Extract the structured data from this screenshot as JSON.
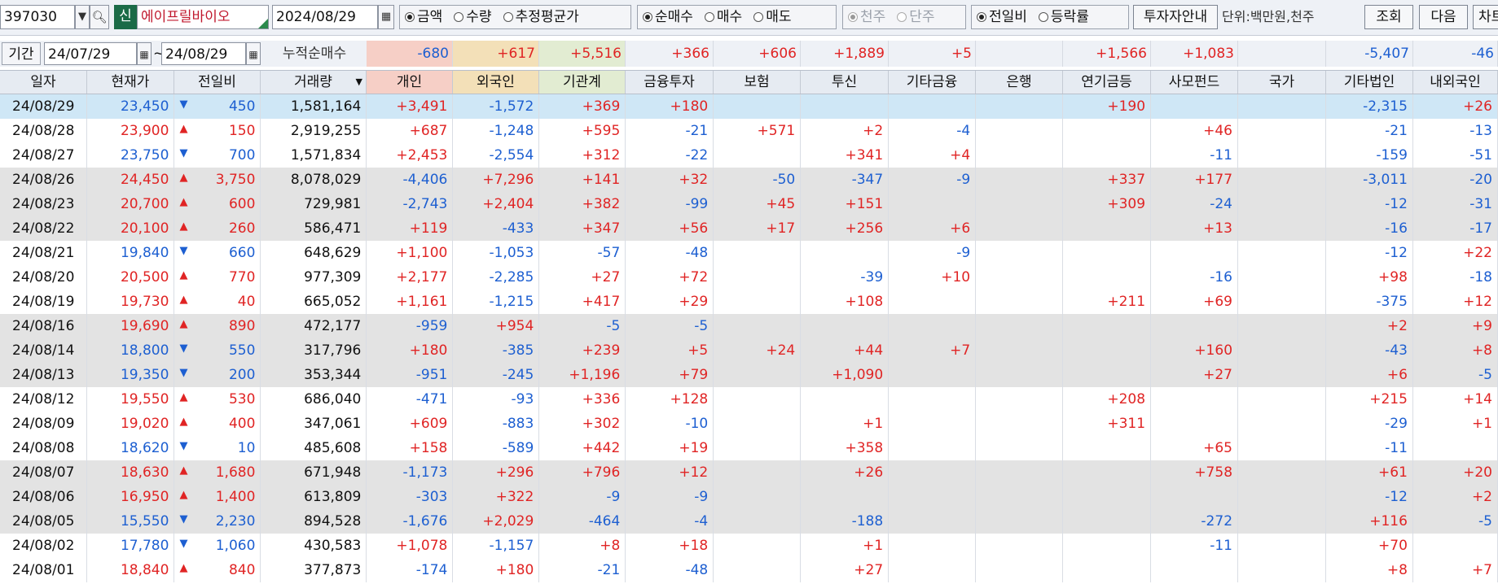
{
  "toolbar": {
    "code": "397030",
    "badge": "신",
    "name": "에이프릴바이오",
    "date": "2024/08/29",
    "value_type": [
      "금액",
      "수량",
      "추정평균가"
    ],
    "trade_type": [
      "순매수",
      "매수",
      "매도"
    ],
    "unit_type": [
      "천주",
      "단주"
    ],
    "compare_type": [
      "전일비",
      "등락률"
    ],
    "guide_button": "투자자안내",
    "unit_text": "단위:백만원,천주",
    "query_button": "조회",
    "next_button": "다음",
    "chart_button": "차트"
  },
  "period": {
    "label": "기간",
    "from": "24/07/29",
    "tilde": "~",
    "to": "24/08/29",
    "cumulative_label": "누적순매수",
    "cumulative_values": [
      "-680",
      "+617",
      "+5,516",
      "+366",
      "+606",
      "+1,889",
      "+5",
      "",
      "+1,566",
      "+1,083",
      "",
      "-5,407",
      "-46"
    ]
  },
  "colors": {
    "positive": "#e02424",
    "negative": "#1d5fd1",
    "selected_row": "#cfe7f6",
    "group_row": "#e3e3e3",
    "individual_header": "#f6cfc6",
    "foreign_header": "#f3e0b8",
    "institution_header": "#e2ecd2"
  },
  "columns": [
    "일자",
    "현재가",
    "전일비",
    "거래량",
    "개인",
    "외국인",
    "기관계",
    "금융투자",
    "보험",
    "투신",
    "기타금융",
    "은행",
    "연기금등",
    "사모펀드",
    "국가",
    "기타법인",
    "내외국인"
  ],
  "rows": [
    [
      "24/08/29",
      "23,450",
      "dn",
      "450",
      "1,581,164",
      "+3,491",
      "-1,572",
      "+369",
      "+180",
      "",
      "",
      "",
      "",
      "+190",
      "",
      "",
      "-2,315",
      "+26"
    ],
    [
      "24/08/28",
      "23,900",
      "up",
      "150",
      "2,919,255",
      "+687",
      "-1,248",
      "+595",
      "-21",
      "+571",
      "+2",
      "-4",
      "",
      "",
      "+46",
      "",
      "-21",
      "-13"
    ],
    [
      "24/08/27",
      "23,750",
      "dn",
      "700",
      "1,571,834",
      "+2,453",
      "-2,554",
      "+312",
      "-22",
      "",
      "+341",
      "+4",
      "",
      "",
      "-11",
      "",
      "-159",
      "-51"
    ],
    [
      "24/08/26",
      "24,450",
      "up",
      "3,750",
      "8,078,029",
      "-4,406",
      "+7,296",
      "+141",
      "+32",
      "-50",
      "-347",
      "-9",
      "",
      "+337",
      "+177",
      "",
      "-3,011",
      "-20"
    ],
    [
      "24/08/23",
      "20,700",
      "up",
      "600",
      "729,981",
      "-2,743",
      "+2,404",
      "+382",
      "-99",
      "+45",
      "+151",
      "",
      "",
      "+309",
      "-24",
      "",
      "-12",
      "-31"
    ],
    [
      "24/08/22",
      "20,100",
      "up",
      "260",
      "586,471",
      "+119",
      "-433",
      "+347",
      "+56",
      "+17",
      "+256",
      "+6",
      "",
      "",
      "+13",
      "",
      "-16",
      "-17"
    ],
    [
      "24/08/21",
      "19,840",
      "dn",
      "660",
      "648,629",
      "+1,100",
      "-1,053",
      "-57",
      "-48",
      "",
      "",
      "-9",
      "",
      "",
      "",
      "",
      "-12",
      "+22"
    ],
    [
      "24/08/20",
      "20,500",
      "up",
      "770",
      "977,309",
      "+2,177",
      "-2,285",
      "+27",
      "+72",
      "",
      "-39",
      "+10",
      "",
      "",
      "-16",
      "",
      "+98",
      "-18"
    ],
    [
      "24/08/19",
      "19,730",
      "up",
      "40",
      "665,052",
      "+1,161",
      "-1,215",
      "+417",
      "+29",
      "",
      "+108",
      "",
      "",
      "+211",
      "+69",
      "",
      "-375",
      "+12"
    ],
    [
      "24/08/16",
      "19,690",
      "up",
      "890",
      "472,177",
      "-959",
      "+954",
      "-5",
      "-5",
      "",
      "",
      "",
      "",
      "",
      "",
      "",
      "+2",
      "+9"
    ],
    [
      "24/08/14",
      "18,800",
      "dn",
      "550",
      "317,796",
      "+180",
      "-385",
      "+239",
      "+5",
      "+24",
      "+44",
      "+7",
      "",
      "",
      "+160",
      "",
      "-43",
      "+8"
    ],
    [
      "24/08/13",
      "19,350",
      "dn",
      "200",
      "353,344",
      "-951",
      "-245",
      "+1,196",
      "+79",
      "",
      "+1,090",
      "",
      "",
      "",
      "+27",
      "",
      "+6",
      "-5"
    ],
    [
      "24/08/12",
      "19,550",
      "up",
      "530",
      "686,040",
      "-471",
      "-93",
      "+336",
      "+128",
      "",
      "",
      "",
      "",
      "+208",
      "",
      "",
      "+215",
      "+14"
    ],
    [
      "24/08/09",
      "19,020",
      "up",
      "400",
      "347,061",
      "+609",
      "-883",
      "+302",
      "-10",
      "",
      "+1",
      "",
      "",
      "+311",
      "",
      "",
      "-29",
      "+1"
    ],
    [
      "24/08/08",
      "18,620",
      "dn",
      "10",
      "485,608",
      "+158",
      "-589",
      "+442",
      "+19",
      "",
      "+358",
      "",
      "",
      "",
      "+65",
      "",
      "-11",
      ""
    ],
    [
      "24/08/07",
      "18,630",
      "up",
      "1,680",
      "671,948",
      "-1,173",
      "+296",
      "+796",
      "+12",
      "",
      "+26",
      "",
      "",
      "",
      "+758",
      "",
      "+61",
      "+20"
    ],
    [
      "24/08/06",
      "16,950",
      "up",
      "1,400",
      "613,809",
      "-303",
      "+322",
      "-9",
      "-9",
      "",
      "",
      "",
      "",
      "",
      "",
      "",
      "-12",
      "+2"
    ],
    [
      "24/08/05",
      "15,550",
      "dn",
      "2,230",
      "894,528",
      "-1,676",
      "+2,029",
      "-464",
      "-4",
      "",
      "-188",
      "",
      "",
      "",
      "-272",
      "",
      "+116",
      "-5"
    ],
    [
      "24/08/02",
      "17,780",
      "dn",
      "1,060",
      "430,583",
      "+1,078",
      "-1,157",
      "+8",
      "+18",
      "",
      "+1",
      "",
      "",
      "",
      "-11",
      "",
      "+70",
      ""
    ],
    [
      "24/08/01",
      "18,840",
      "up",
      "840",
      "377,873",
      "-174",
      "+180",
      "-21",
      "-48",
      "",
      "+27",
      "",
      "",
      "",
      "",
      "",
      "+8",
      "+7"
    ]
  ]
}
